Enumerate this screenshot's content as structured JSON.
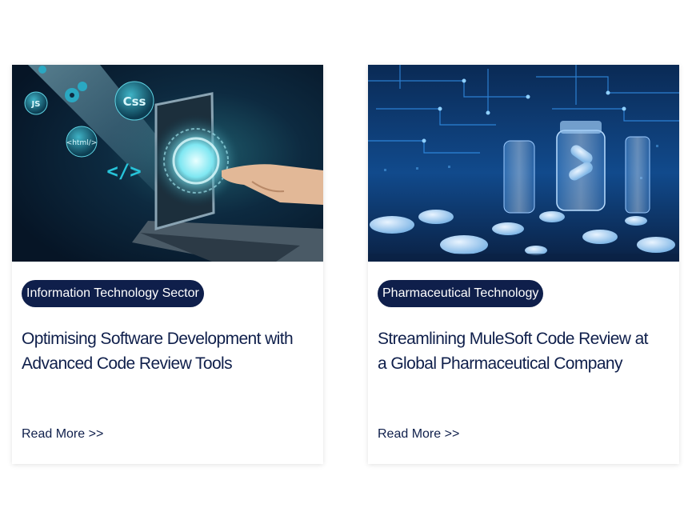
{
  "cards": [
    {
      "category": "Information Technology Sector",
      "title": "Optimising Software Development with Advanced Code Review Tools",
      "read_more": "Read More >>",
      "image": {
        "description": "hand touching glowing laptop screen with floating code badges",
        "badge_labels": [
          "JS",
          "Css",
          "<html/>",
          "</>"
        ]
      }
    },
    {
      "category": "Pharmaceutical Technology",
      "title": "Streamlining MuleSoft Code Review at a Global Pharmaceutical Company",
      "read_more": "Read More >>",
      "image": {
        "description": "blue circuit board with pill bottles and tablets"
      }
    }
  ],
  "colors": {
    "brand_navy": "#0f1f4b",
    "image_teal": "#27c3d9",
    "image_blue": "#1b6fd0"
  }
}
